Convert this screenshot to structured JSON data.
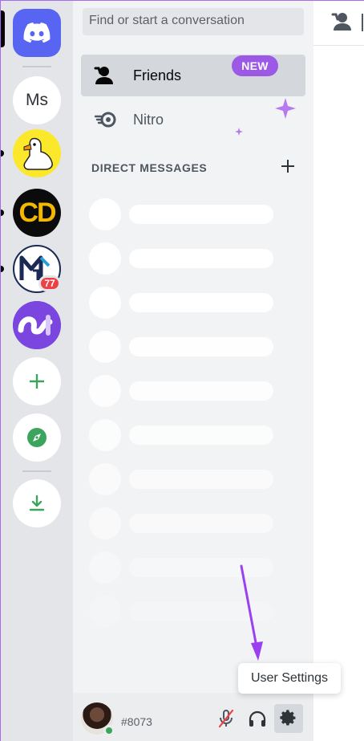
{
  "search": {
    "placeholder": "Find or start a conversation"
  },
  "nav": {
    "friends_label": "Friends",
    "nitro_label": "Nitro",
    "nitro_badge": "NEW"
  },
  "dm": {
    "header": "DIRECT MESSAGES"
  },
  "servers": {
    "ms_label": "Ms",
    "cd_label": "CD",
    "mention_count": "77"
  },
  "user": {
    "tag": "#8073"
  },
  "tooltip": {
    "label": "User Settings"
  },
  "colors": {
    "brand": "#5865f2",
    "badge_red": "#ed4245",
    "nitro_purple": "#9b59e6",
    "online_green": "#3ba55d",
    "add_green": "#3ba55d",
    "annotation_arrow": "#9b40f0"
  },
  "icons": {
    "home": "discord-logo-icon",
    "friends": "friends-icon",
    "nitro": "nitro-icon",
    "add_dm": "plus-icon",
    "add_server": "plus-icon",
    "explore": "compass-icon",
    "download": "download-icon",
    "mute": "microphone-muted-icon",
    "deafen": "headphones-icon",
    "settings": "gear-icon"
  }
}
